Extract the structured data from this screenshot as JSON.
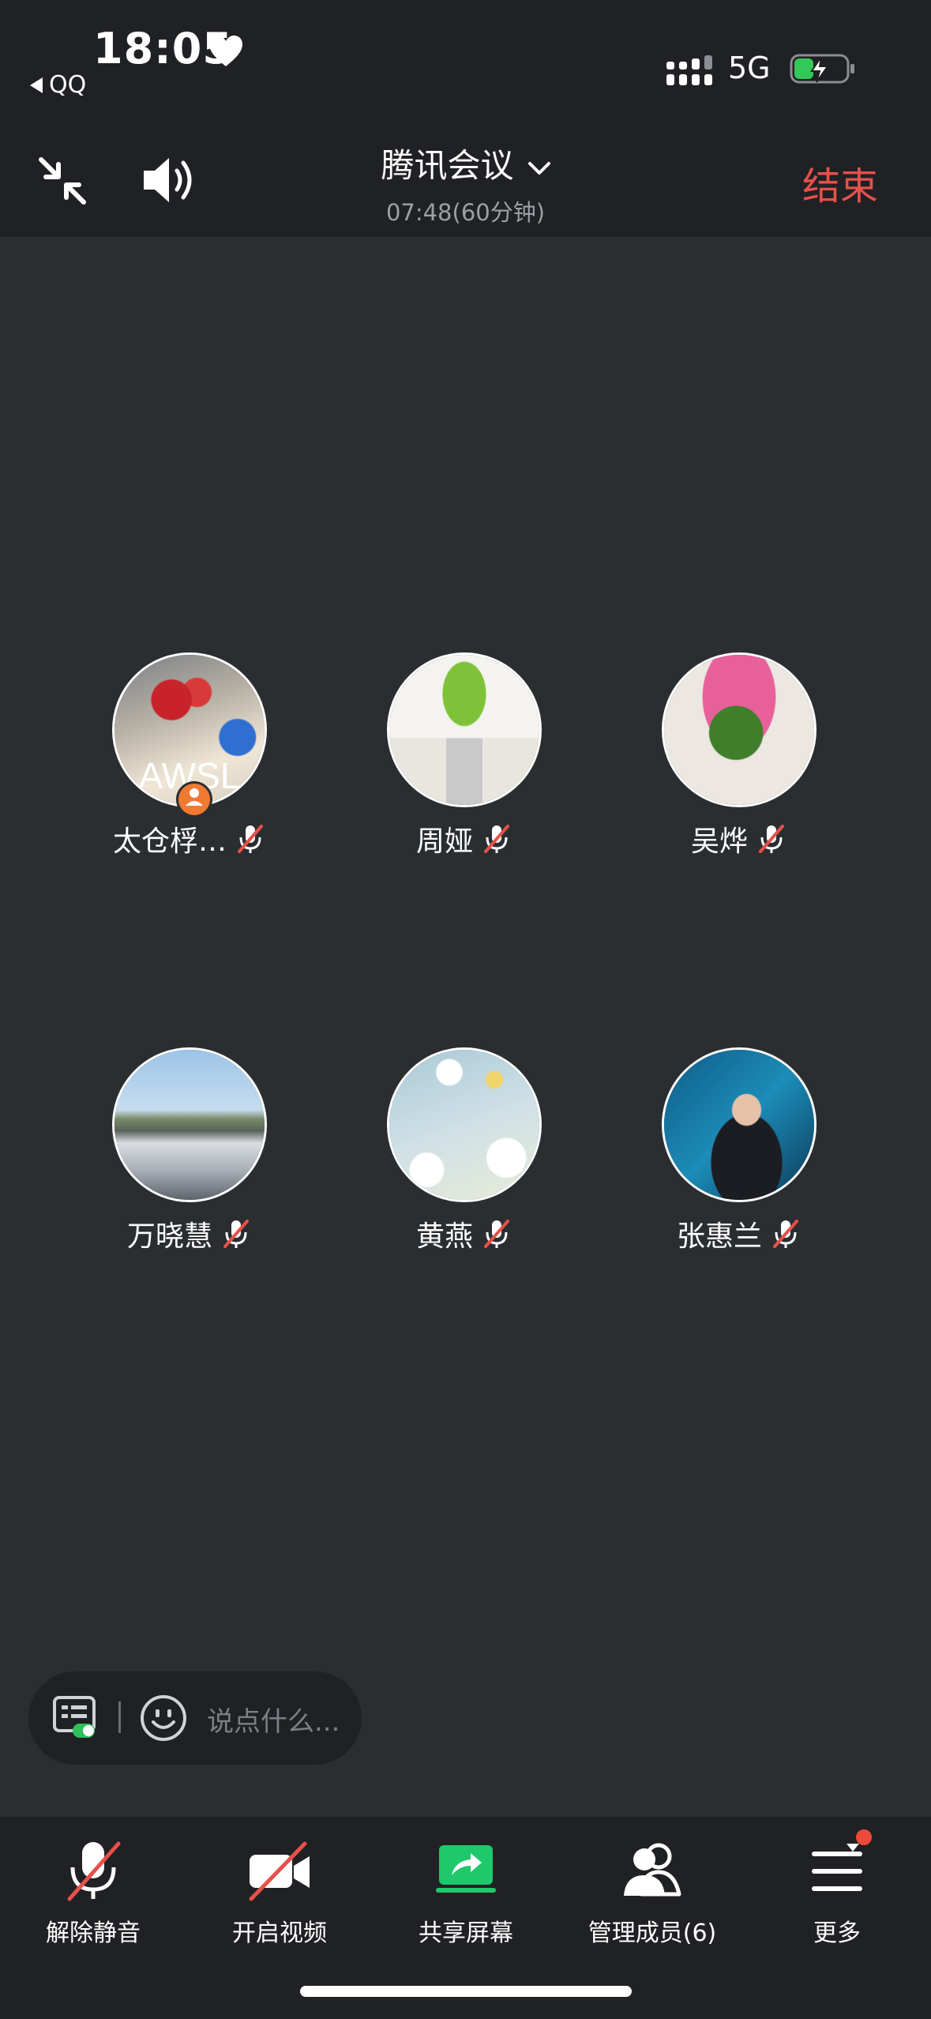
{
  "status_bar": {
    "time": "18:05",
    "back_app": "QQ",
    "network": "5G",
    "heart_icon": "heart-icon",
    "signal_icon": "signal-bars-icon",
    "battery_icon": "battery-charging-icon",
    "battery_color": "#34c759"
  },
  "header": {
    "title": "腾讯会议",
    "time": "07:48(60分钟)",
    "end_label": "结束",
    "end_color": "#e8504a",
    "collapse_icon": "collapse-arrows-icon",
    "speaker_icon": "speaker-icon",
    "dropdown_icon": "chevron-down-icon"
  },
  "participants": [
    {
      "name": "太仓桴…",
      "muted": true,
      "host": true,
      "avatar_label": "AWSL"
    },
    {
      "name": "周娅",
      "muted": true
    },
    {
      "name": "吴烨",
      "muted": true
    },
    {
      "name": "万晓慧",
      "muted": true
    },
    {
      "name": "黄燕",
      "muted": true
    },
    {
      "name": "张惠兰",
      "muted": true
    }
  ],
  "chat": {
    "placeholder": "说点什么...",
    "list_icon": "chat-list-icon",
    "emoji_icon": "emoji-icon"
  },
  "toolbar": {
    "unmute": "解除静音",
    "start_video": "开启视频",
    "share_screen": "共享屏幕",
    "manage_members": "管理成员(6)",
    "more": "更多",
    "share_color": "#1ec86b",
    "badge_color": "#ee4a3b"
  }
}
